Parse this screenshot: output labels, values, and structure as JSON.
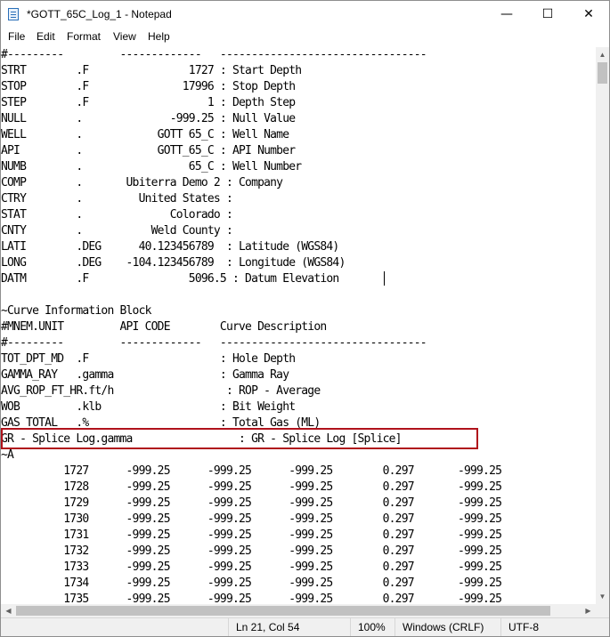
{
  "window": {
    "title": "*GOTT_65C_Log_1 - Notepad",
    "controls": {
      "minimize": "—",
      "maximize": "☐",
      "close": "✕"
    }
  },
  "menu": [
    "File",
    "Edit",
    "Format",
    "View",
    "Help"
  ],
  "editor": {
    "lines": [
      "#---------         -------------   ---------------------------------",
      "STRT        .F                1727 : Start Depth",
      "STOP        .F               17996 : Stop Depth",
      "STEP        .F                   1 : Depth Step",
      "NULL        .              -999.25 : Null Value",
      "WELL        .            GOTT 65_C : Well Name",
      "API         .            GOTT_65_C : API Number",
      "NUMB        .                 65_C : Well Number",
      "COMP        .       Ubiterra Demo 2 : Company",
      "CTRY        .         United States :",
      "STAT        .              Colorado :",
      "CNTY        .           Weld County :",
      "LATI        .DEG      40.123456789  : Latitude (WGS84)",
      "LONG        .DEG    -104.123456789  : Longitude (WGS84)",
      "DATM        .F                5096.5 : Datum Elevation",
      "",
      "~Curve Information Block",
      "#MNEM.UNIT         API CODE        Curve Description",
      "#---------         -------------   ---------------------------------",
      "TOT_DPT_MD  .F                     : Hole Depth",
      "GAMMA_RAY   .gamma                 : Gamma Ray",
      "AVG_ROP_FT_HR.ft/h                  : ROP - Average",
      "WOB         .klb                   : Bit Weight",
      "GAS_TOTAL   .%                     : Total Gas (ML)",
      "GR - Splice Log.gamma                 : GR - Splice Log [Splice]",
      "~A",
      "          1727      -999.25      -999.25      -999.25        0.297       -999.25",
      "          1728      -999.25      -999.25      -999.25        0.297       -999.25",
      "          1729      -999.25      -999.25      -999.25        0.297       -999.25",
      "          1730      -999.25      -999.25      -999.25        0.297       -999.25",
      "          1731      -999.25      -999.25      -999.25        0.297       -999.25",
      "          1732      -999.25      -999.25      -999.25        0.297       -999.25",
      "          1733      -999.25      -999.25      -999.25        0.297       -999.25",
      "          1734      -999.25      -999.25      -999.25        0.297       -999.25",
      "          1735      -999.25      -999.25      -999.25        0.297       -999.25"
    ]
  },
  "scroll": {
    "up": "▲",
    "down": "▼",
    "left": "◀",
    "right": "▶"
  },
  "status": {
    "position": "Ln 21, Col 54",
    "zoom": "100%",
    "line_ending": "Windows (CRLF)",
    "encoding": "UTF-8"
  }
}
